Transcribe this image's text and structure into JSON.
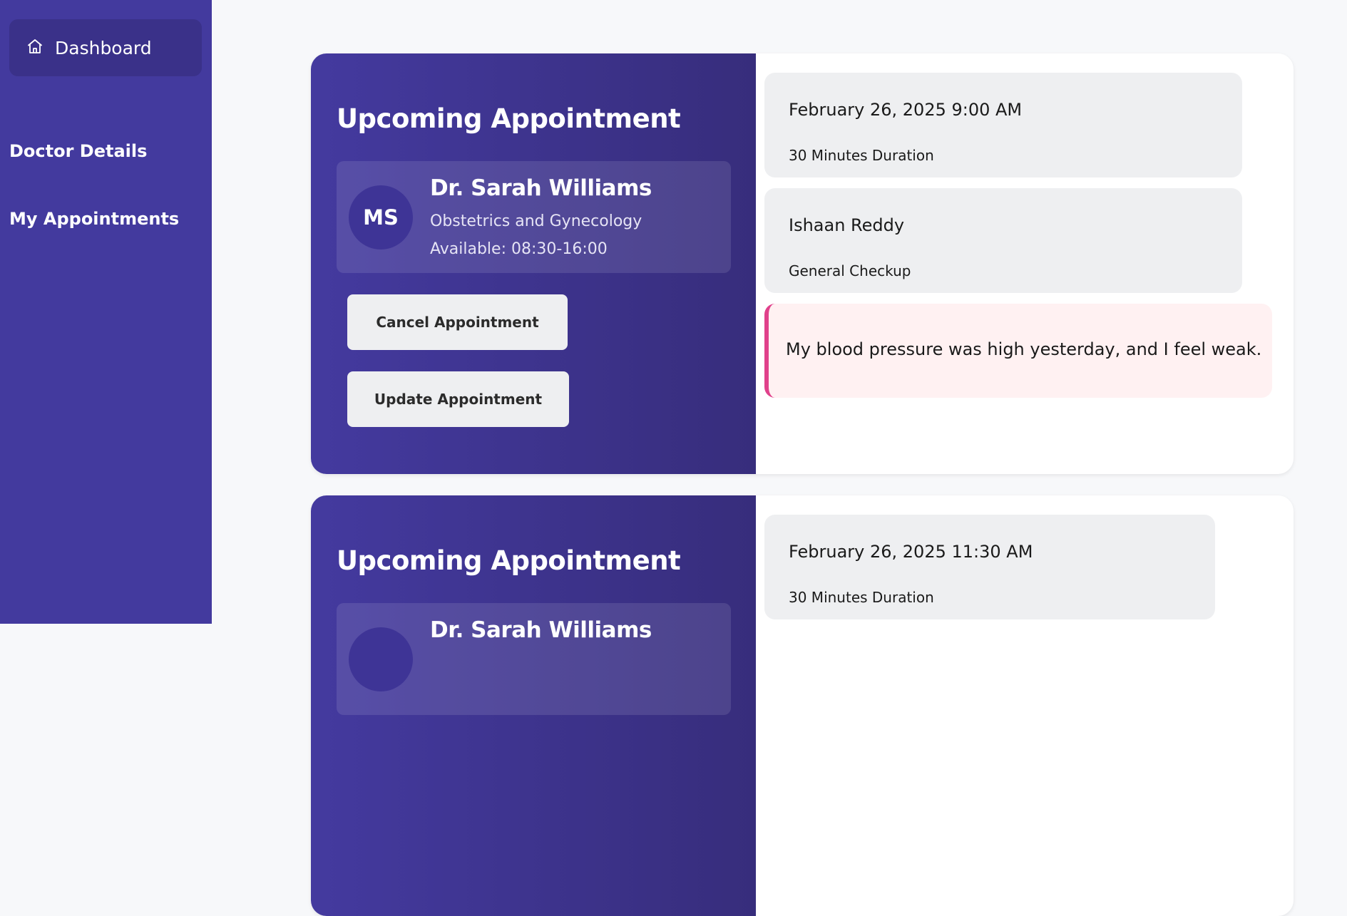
{
  "sidebar": {
    "dashboard_label": "Dashboard",
    "doctor_details_label": "Doctor Details",
    "my_appointments_label": "My Appointments",
    "bg_color": "#433a9e",
    "active_bg_color": "#3a3189"
  },
  "appointments": [
    {
      "title": "Upcoming Appointment",
      "doctor": {
        "initials": "MS",
        "name": "Dr. Sarah Williams",
        "specialty": "Obstetrics and Gynecology",
        "availability": "Available: 08:30-16:00"
      },
      "cancel_label": "Cancel Appointment",
      "update_label": "Update Appointment",
      "datetime": "February 26, 2025 9:00 AM",
      "duration": "30 Minutes Duration",
      "patient_name": "Ishaan Reddy",
      "visit_type": "General Checkup",
      "note": "My blood pressure was high yesterday, and I feel weak."
    },
    {
      "title": "Upcoming Appointment",
      "doctor": {
        "initials": "",
        "name": "Dr. Sarah Williams"
      },
      "datetime": "February 26, 2025 11:30 AM",
      "duration": "30 Minutes Duration"
    }
  ],
  "colors": {
    "accent": "#443a9f",
    "note_border": "#e0418b",
    "note_bg": "#fff1f2"
  },
  "icons": {
    "dashboard": "home-icon"
  }
}
